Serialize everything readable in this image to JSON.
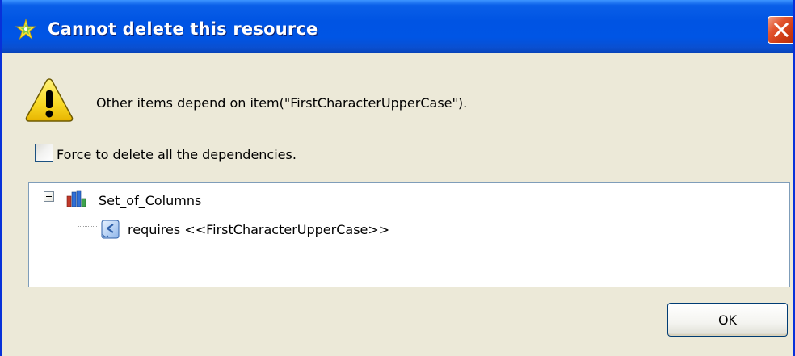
{
  "dialog": {
    "title": "Cannot delete this resource",
    "message": "Other items depend on item(\"FirstCharacterUpperCase\").",
    "icons": {
      "title": "sparkle-app-icon",
      "close": "close-icon",
      "message": "warning-icon"
    }
  },
  "force_delete": {
    "label": "Force to delete all the dependencies.",
    "checked": false
  },
  "tree": {
    "root": {
      "label": "Set_of_Columns",
      "icon": "column-set-icon",
      "expanded": true
    },
    "children": [
      {
        "label": "requires <<FirstCharacterUpperCase>>",
        "icon": "rule-document-icon"
      }
    ]
  },
  "buttons": {
    "ok_label": "OK"
  },
  "colors": {
    "titlebar": "#0054E3",
    "dialog_background": "#ECE9D8",
    "close_button": "#E2542E",
    "tree_border": "#7F9DB9"
  }
}
